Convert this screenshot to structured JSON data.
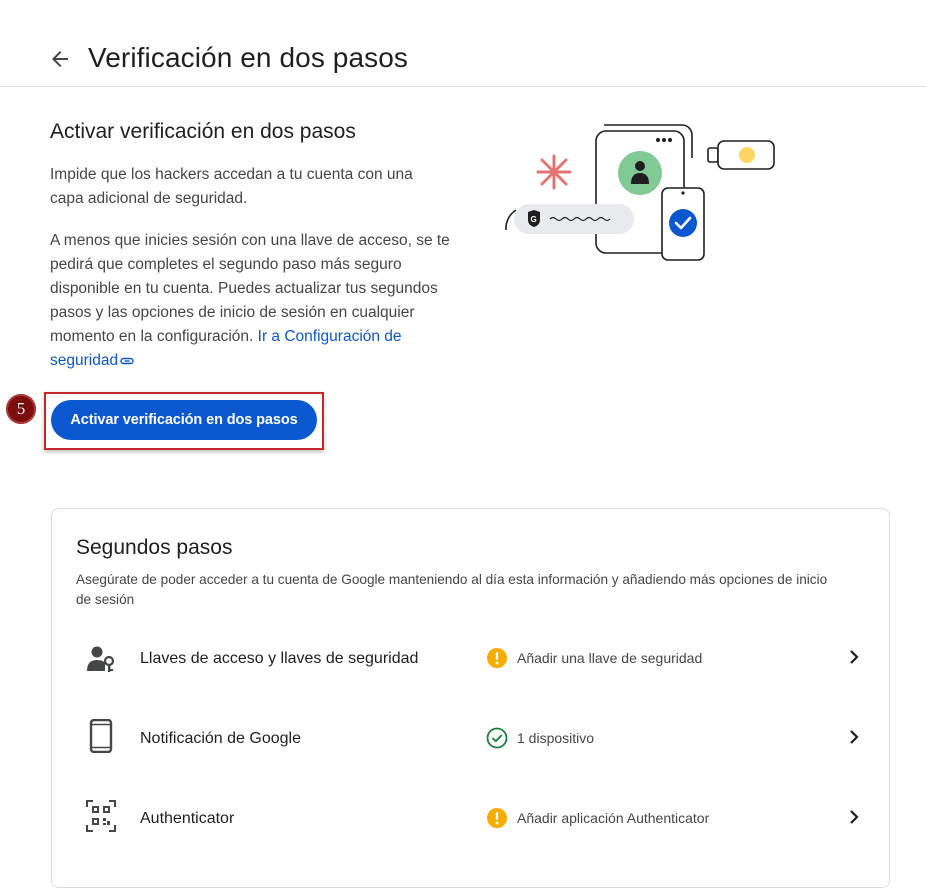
{
  "header": {
    "title": "Verificación en dos pasos"
  },
  "intro": {
    "title": "Activar verificación en dos pasos",
    "paragraph1": "Impide que los hackers accedan a tu cuenta con una capa adicional de seguridad.",
    "paragraph2": "A menos que inicies sesión con una llave de acceso, se te pedirá que completes el segundo paso más seguro disponible en tu cuenta. Puedes actualizar tus segundos pasos y las opciones de inicio de sesión en cualquier momento en la configuración.",
    "link_text": "Ir a Configuración de seguridad",
    "button_label": "Activar verificación en dos pasos"
  },
  "annotation": {
    "step_number": "5"
  },
  "second_steps": {
    "title": "Segundos pasos",
    "description": "Asegúrate de poder acceder a tu cuenta de Google manteniendo al día esta información y añadiendo más opciones de inicio de sesión",
    "items": [
      {
        "label": "Llaves de acceso y llaves de seguridad",
        "status": "Añadir una llave de seguridad",
        "status_type": "warning",
        "icon": "passkey-icon"
      },
      {
        "label": "Notificación de Google",
        "status": "1 dispositivo",
        "status_type": "ok",
        "icon": "phone-icon"
      },
      {
        "label": "Authenticator",
        "status": "Añadir aplicación Authenticator",
        "status_type": "warning",
        "icon": "qr-code-icon"
      }
    ]
  },
  "colors": {
    "accent": "#0b57d0",
    "warning": "#f9ab00",
    "success": "#188038",
    "highlight": "#c62828",
    "badge": "#7b0d0d"
  }
}
